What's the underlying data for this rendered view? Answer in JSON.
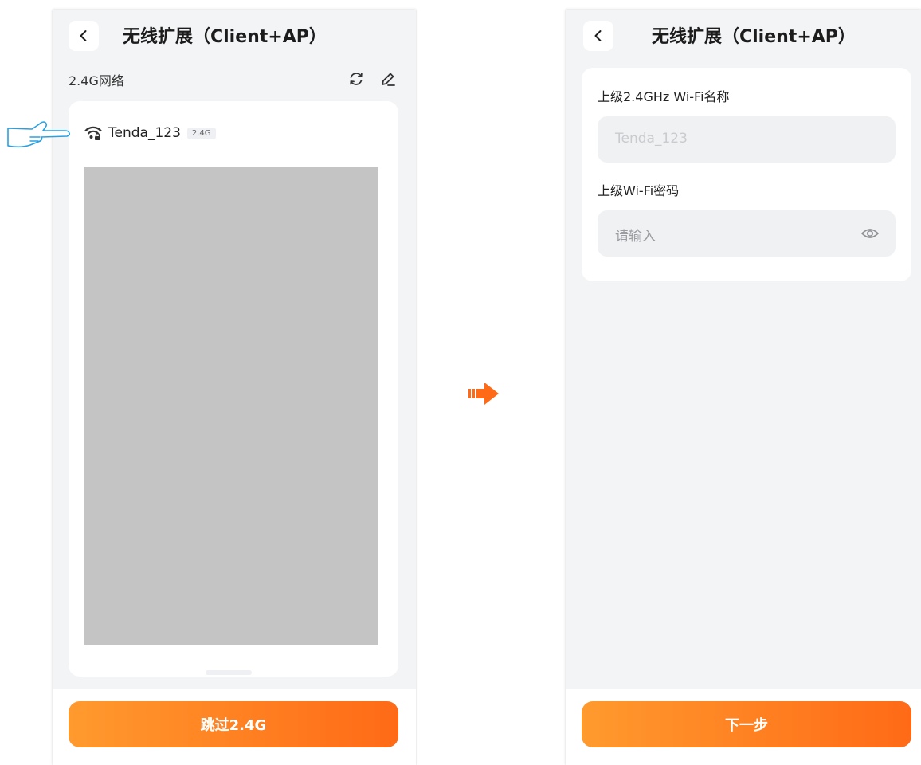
{
  "left_screen": {
    "header": {
      "title": "无线扩展（Client+AP）"
    },
    "section_title": "2.4G网络",
    "network": {
      "ssid": "Tenda_123",
      "band": "2.4G"
    },
    "footer": {
      "button_label": "跳过2.4G"
    }
  },
  "right_screen": {
    "header": {
      "title": "无线扩展（Client+AP）"
    },
    "form": {
      "ssid_label": "上级2.4GHz Wi-Fi名称",
      "ssid_value": "Tenda_123",
      "password_label": "上级Wi-Fi密码",
      "password_placeholder": "请输入"
    },
    "footer": {
      "button_label": "下一步"
    }
  },
  "colors": {
    "accent_start": "#ff9a2e",
    "accent_end": "#ff6a16",
    "arrow": "#ff6a16",
    "pointer": "#2aa0e0"
  },
  "icons": [
    "chevron-left-icon",
    "refresh-icon",
    "edit-icon",
    "wifi-locked-icon",
    "eye-icon",
    "pointer-hand-icon",
    "arrow-right-icon"
  ]
}
